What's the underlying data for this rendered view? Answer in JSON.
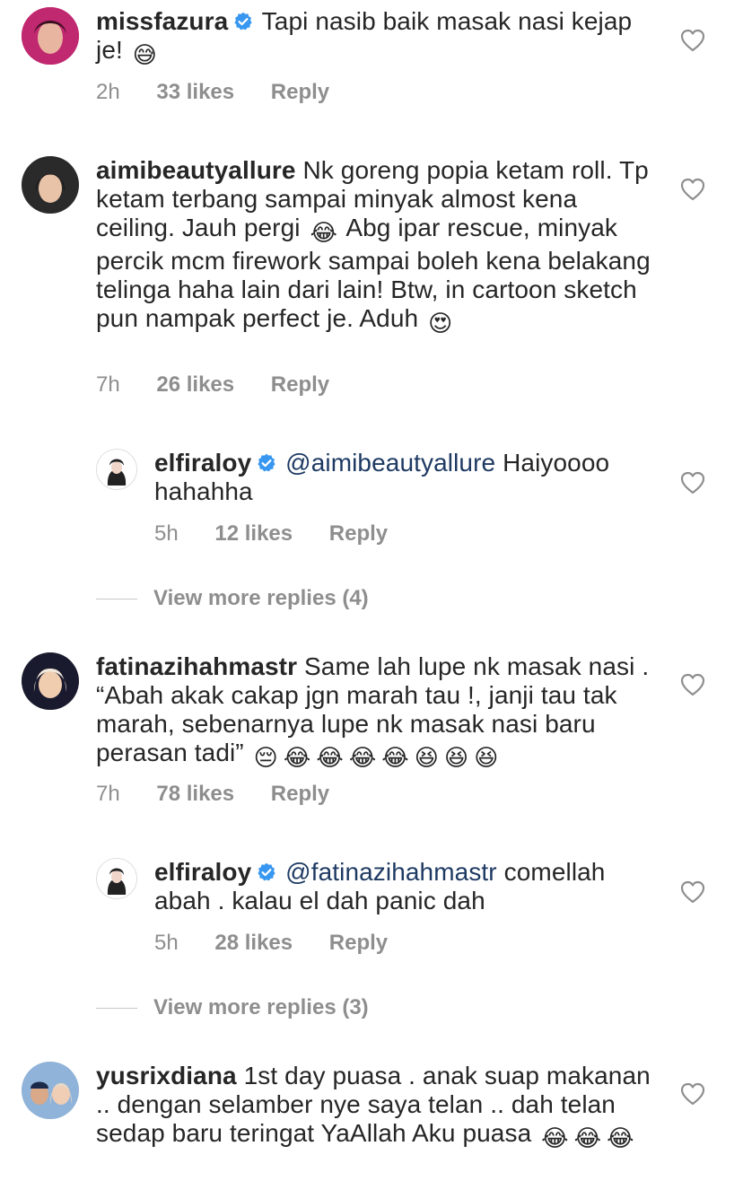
{
  "comments": [
    {
      "username": "missfazura",
      "verified": true,
      "text": "Tapi nasib baik masak nasi kejap je!",
      "emojis": [
        "😅"
      ],
      "time": "2h",
      "likes": "33 likes",
      "reply_label": "Reply"
    },
    {
      "username": "aimibeautyallure",
      "verified": false,
      "text_1": "Nk goreng popia ketam roll. Tp ketam terbang sampai minyak almost kena ceiling. Jauh pergi",
      "text_2": "Abg ipar rescue, minyak percik mcm firework sampai boleh kena belakang telinga haha lain dari lain! Btw, in cartoon sketch pun nampak perfect je. Aduh",
      "emojis": [
        "😂",
        "😍"
      ],
      "time": "7h",
      "likes": "26 likes",
      "reply_label": "Reply",
      "replies": [
        {
          "username": "elfiraloy",
          "verified": true,
          "mention": "@aimibeautyallure",
          "text": "Haiyoooo hahahha",
          "time": "5h",
          "likes": "12 likes",
          "reply_label": "Reply"
        }
      ],
      "view_more": "View more replies (4)"
    },
    {
      "username": "fatinazihahmastr",
      "verified": false,
      "text": "Same lah lupe nk masak nasi . “Abah akak cakap jgn marah tau !, janji tau tak marah, sebenarnya lupe nk masak nasi baru perasan tadi”",
      "emojis": [
        "😔",
        "😂",
        "😂",
        "😂",
        "😂",
        "😆",
        "😆",
        "😆"
      ],
      "time": "7h",
      "likes": "78 likes",
      "reply_label": "Reply",
      "replies": [
        {
          "username": "elfiraloy",
          "verified": true,
          "mention": "@fatinazihahmastr",
          "text": "comellah abah . kalau el dah panic dah",
          "time": "5h",
          "likes": "28 likes",
          "reply_label": "Reply"
        }
      ],
      "view_more": "View more replies (3)"
    },
    {
      "username": "yusrixdiana",
      "verified": false,
      "text": "1st day puasa . anak suap makanan .. dengan selamber nye saya telan .. dah telan sedap baru teringat YaAllah Aku puasa",
      "emojis": [
        "😂",
        "😂",
        "😂"
      ]
    }
  ],
  "colors": {
    "text": "#262626",
    "meta": "#8e8e8e",
    "mention": "#1e3a63",
    "verified": "#3897f0"
  },
  "icons": {
    "like": "heart-outline-icon",
    "verified": "verified-badge-icon"
  }
}
